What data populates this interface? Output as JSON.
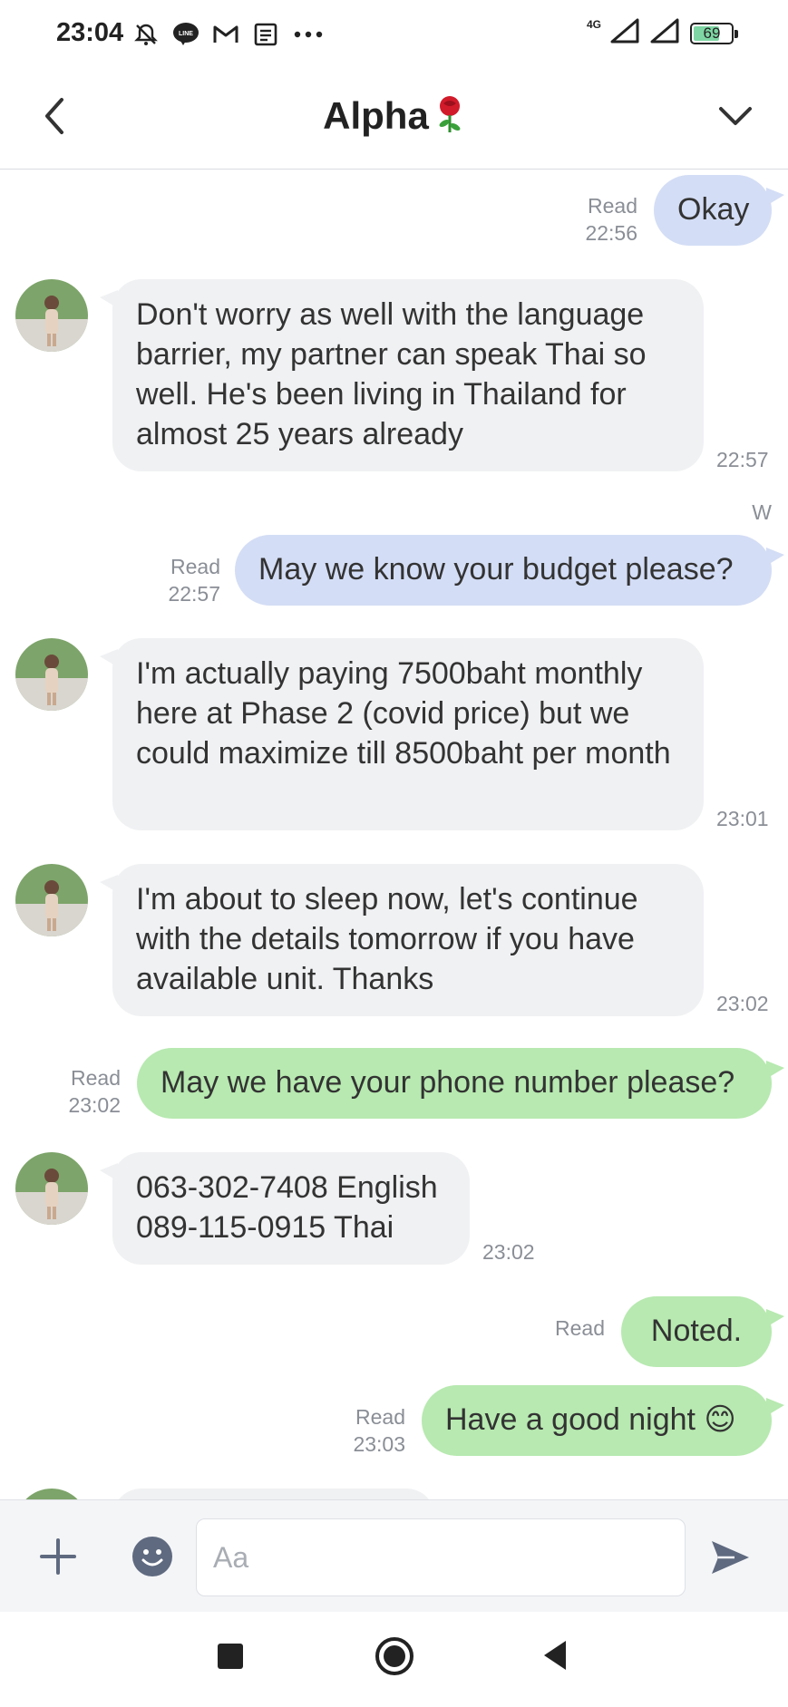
{
  "status_bar": {
    "time": "23:04",
    "icons_left": [
      "dnd-off-icon",
      "line-app-icon",
      "gmail-icon",
      "news-icon",
      "more-icon"
    ],
    "network": "4G",
    "battery": "69"
  },
  "header": {
    "title": "Alpha",
    "title_emoji": "🌹"
  },
  "messages": [
    {
      "side": "out",
      "text": "Okay",
      "read": "Read",
      "time": "22:56"
    },
    {
      "side": "in",
      "text": "Don't worry as well with the language barrier, my partner can speak Thai so well. He's been living in Thailand for almost 25 years already",
      "time": "22:57"
    },
    {
      "side": "out",
      "sender": "W",
      "text": "May we know your budget please?",
      "read": "Read",
      "time": "22:57"
    },
    {
      "side": "in",
      "text": "I'm actually paying 7500baht monthly here at Phase 2 (covid price) but we could maximize till 8500baht per month",
      "time": "23:01"
    },
    {
      "side": "in",
      "text": "I'm about to sleep now, let's continue with the details tomorrow if you have available unit. Thanks",
      "time": "23:02"
    },
    {
      "side": "out",
      "text": "May we have your phone number please?",
      "read": "Read",
      "time": "23:02"
    },
    {
      "side": "in",
      "text": "063-302-7408 English\n089-115-0915 Thai",
      "time": "23:02"
    },
    {
      "side": "out",
      "text": "Noted.",
      "read": "Read",
      "time": ""
    },
    {
      "side": "out",
      "text": "Have a good night 😊",
      "read": "Read",
      "time": "23:03"
    }
  ],
  "input": {
    "placeholder": "Aa"
  },
  "colors": {
    "bubble_in": "#f0f1f3",
    "bubble_out_blue": "#d3ddf5",
    "bubble_out_green": "#b7e9b0",
    "meta_text": "#8a8e96"
  }
}
